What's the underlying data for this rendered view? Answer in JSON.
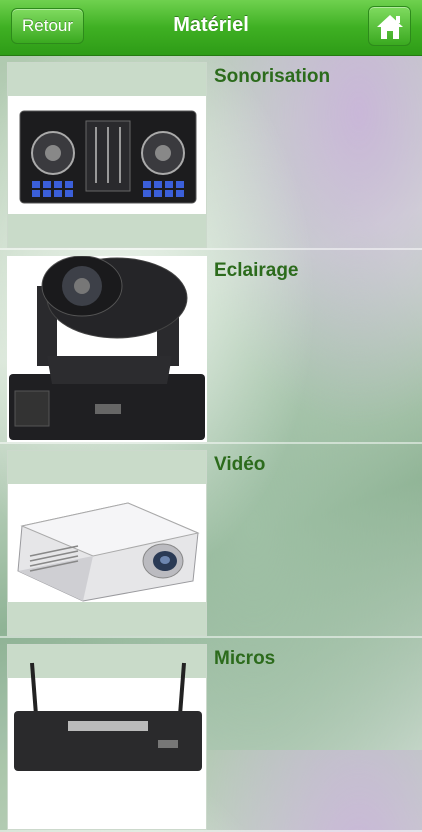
{
  "navbar": {
    "title": "Matériel",
    "back_label": "Retour",
    "home_icon": "home-icon"
  },
  "categories": [
    {
      "label": "Sonorisation",
      "icon": "dj-controller-image"
    },
    {
      "label": "Eclairage",
      "icon": "moving-head-light-image"
    },
    {
      "label": "Vidéo",
      "icon": "projector-image"
    },
    {
      "label": "Micros",
      "icon": "microphone-receiver-image"
    }
  ],
  "colors": {
    "navbar_green": "#3fb023",
    "label_green": "#2c6b1c"
  }
}
